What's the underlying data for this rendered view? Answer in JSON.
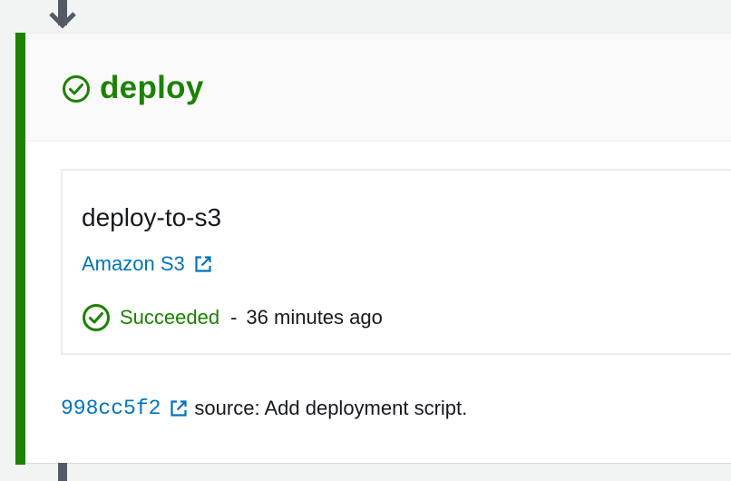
{
  "stage": {
    "name": "deploy",
    "status": "succeeded",
    "accent_color": "#1d8102"
  },
  "action": {
    "name": "deploy-to-s3",
    "provider": "Amazon S3",
    "status_text": "Succeeded",
    "separator": "-",
    "time_ago": "36 minutes ago"
  },
  "commit": {
    "id": "998cc5f2",
    "message": "source: Add deployment script."
  },
  "colors": {
    "success": "#1d8102",
    "link": "#0073bb",
    "connector": "#545b64"
  },
  "icons": {
    "stage_status": "check-circle-icon",
    "action_status": "check-circle-icon",
    "external_link": "external-link-icon",
    "connector_arrow": "arrow-down-icon"
  }
}
